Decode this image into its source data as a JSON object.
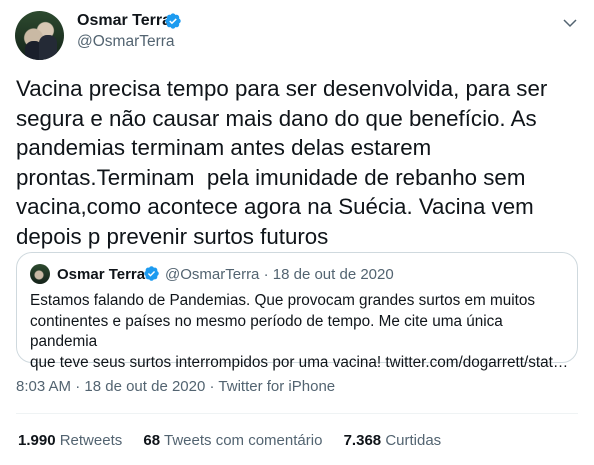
{
  "author": {
    "name": "Osmar Terra",
    "handle": "@OsmarTerra"
  },
  "tweet": {
    "text": "Vacina precisa tempo para ser desenvolvida, para ser segura e não causar mais dano do que benefício. As pandemias terminam antes delas estarem prontas.Terminam  pela imunidade de rebanho sem vacina,como acontece agora na Suécia. Vacina vem depois p prevenir surtos futuros"
  },
  "quote": {
    "name": "Osmar Terra",
    "handle": "@OsmarTerra",
    "separator": "·",
    "date": "18 de out de 2020",
    "text": "Estamos falando de Pandemias. Que provocam grandes surtos em muitos\ncontinentes e países no mesmo período de tempo. Me cite uma única pandemia\nque teve seus surtos interrompidos por uma vacina! twitter.com/dogarrett/stat…"
  },
  "meta": {
    "time": "8:03 AM",
    "sep1": "·",
    "date": "18 de out de 2020",
    "sep2": "·",
    "source": "Twitter for iPhone"
  },
  "stats": {
    "retweets_count": "1.990",
    "retweets_label": "Retweets",
    "comments_count": "68",
    "comments_label": "Tweets com comentário",
    "likes_count": "7.368",
    "likes_label": "Curtidas"
  },
  "colors": {
    "verified": "#1d9bf0",
    "secondary_text": "#536471",
    "border": "#cfd9de"
  },
  "icons": {
    "verified": "verified-badge-icon",
    "menu": "chevron-down-icon"
  }
}
